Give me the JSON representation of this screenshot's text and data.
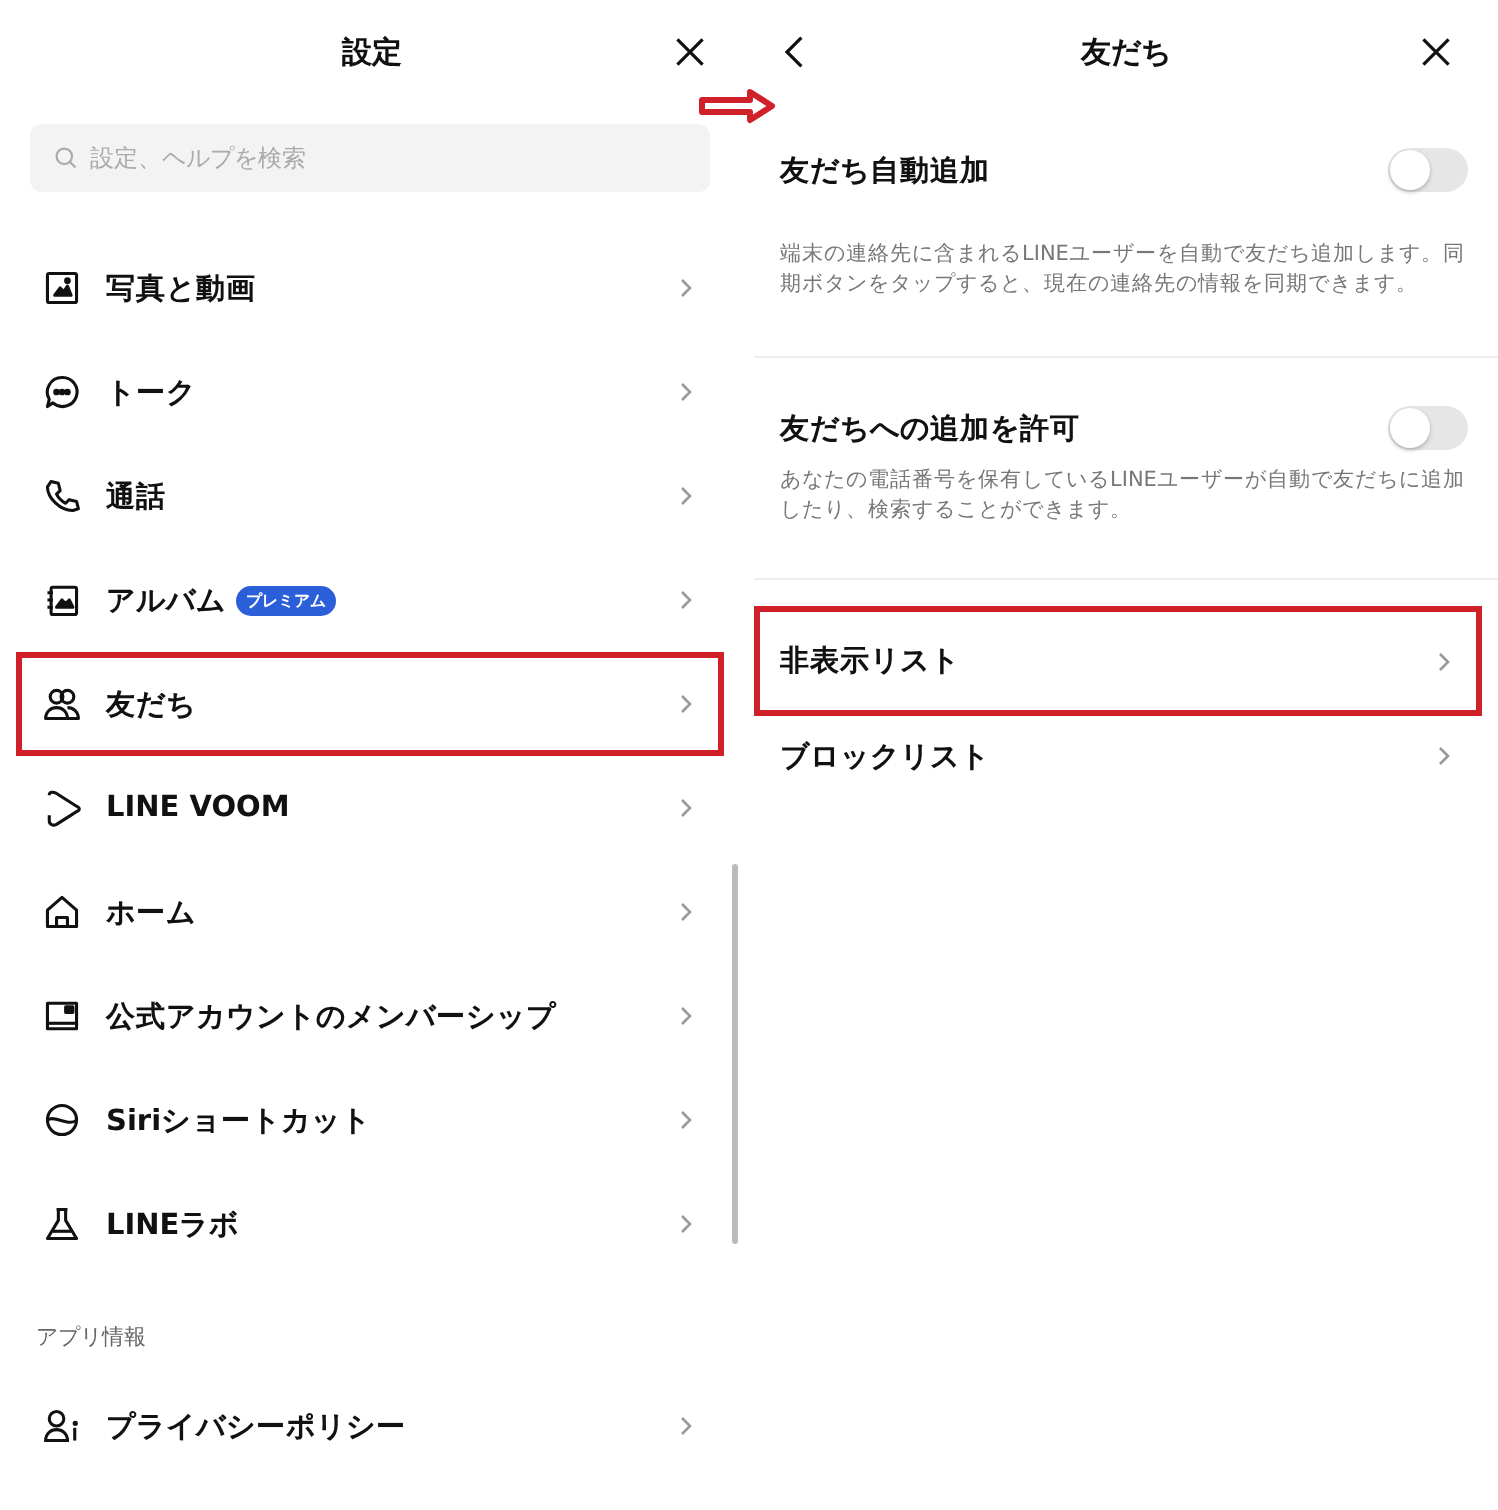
{
  "left": {
    "title": "設定",
    "search": {
      "placeholder": "設定、ヘルプを検索"
    },
    "items": [
      {
        "label": "写真と動画",
        "highlighted": false
      },
      {
        "label": "トーク",
        "highlighted": false
      },
      {
        "label": "通話",
        "highlighted": false
      },
      {
        "label": "アルバム",
        "badge": "プレミアム",
        "highlighted": false
      },
      {
        "label": "友だち",
        "highlighted": true
      },
      {
        "label": "LINE VOOM",
        "highlighted": false
      },
      {
        "label": "ホーム",
        "highlighted": false
      },
      {
        "label": "公式アカウントのメンバーシップ",
        "highlighted": false
      },
      {
        "label": "Siriショートカット",
        "highlighted": false
      },
      {
        "label": "LINEラボ",
        "highlighted": false
      }
    ],
    "section": {
      "heading": "アプリ情報",
      "items": [
        {
          "label": "プライバシーポリシー",
          "highlighted": false
        }
      ]
    }
  },
  "right": {
    "title": "友だち",
    "toggles": [
      {
        "label": "友だち自動追加",
        "on": false,
        "description": "端末の連絡先に含まれるLINEユーザーを自動で友だち追加します。同期ボタンをタップすると、現在の連絡先の情報を同期できます。"
      },
      {
        "label": "友だちへの追加を許可",
        "on": false,
        "description": "あなたの電話番号を保有しているLINEユーザーが自動で友だちに追加したり、検索することができます。"
      }
    ],
    "links": [
      {
        "label": "非表示リスト",
        "highlighted": true
      },
      {
        "label": "ブロックリスト",
        "highlighted": false
      }
    ]
  }
}
